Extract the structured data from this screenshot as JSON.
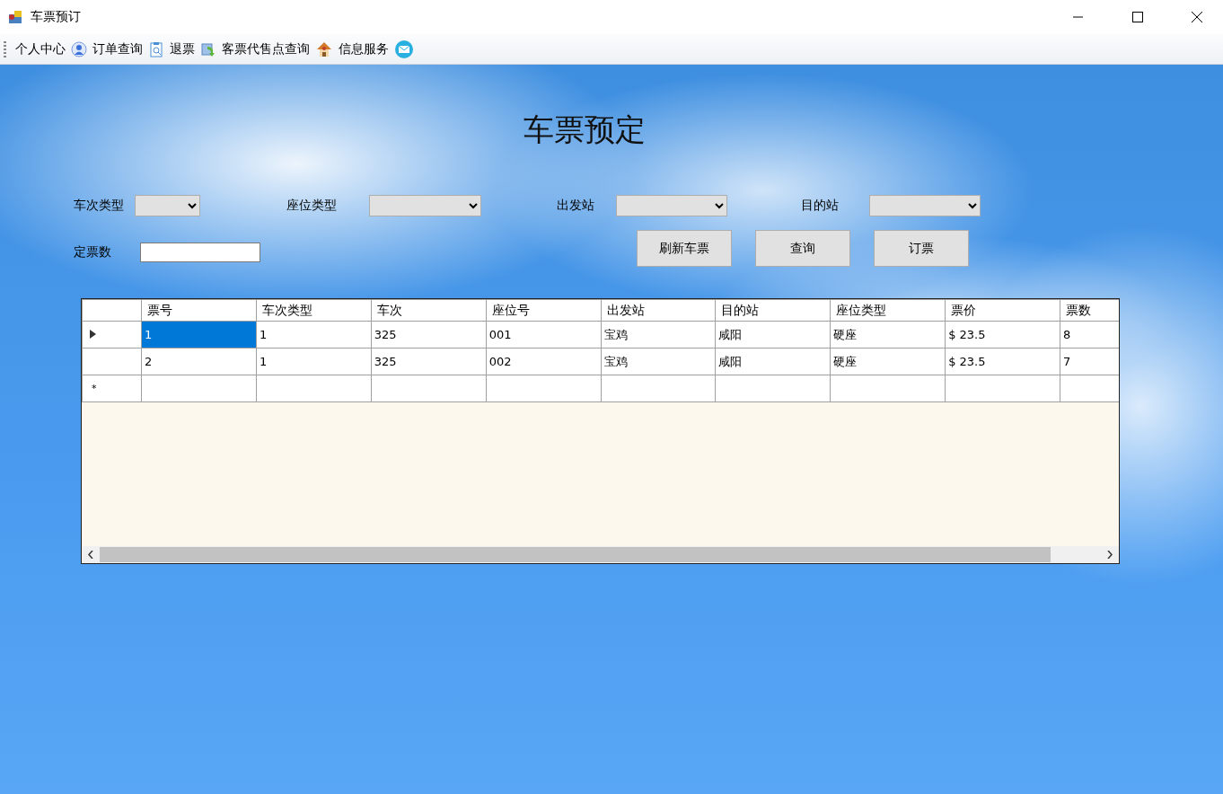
{
  "window": {
    "title": "车票预订"
  },
  "toolbar": [
    "个人中心",
    "订单查询",
    "退票",
    "客票代售点查询",
    "信息服务"
  ],
  "heading": "车票预定",
  "filters": [
    "车次类型",
    "座位类型",
    "出发站",
    "目的站"
  ],
  "quantity": {
    "label": "定票数"
  },
  "buttons": [
    "刷新车票",
    "查询",
    "订票"
  ],
  "table": {
    "columns": [
      "票号",
      "车次类型",
      "车次",
      "座位号",
      "出发站",
      "目的站",
      "座位类型",
      "票价",
      "票数"
    ],
    "rows": [
      {
        "selected": true,
        "cells": [
          "1",
          "1",
          "325",
          "001",
          "宝鸡",
          "咸阳",
          "硬座",
          "$ 23.5",
          "8"
        ]
      },
      {
        "selected": false,
        "cells": [
          "2",
          "1",
          "325",
          "002",
          "宝鸡",
          "咸阳",
          "硬座",
          "$ 23.5",
          "7"
        ]
      }
    ],
    "new_row_marker": "*"
  }
}
